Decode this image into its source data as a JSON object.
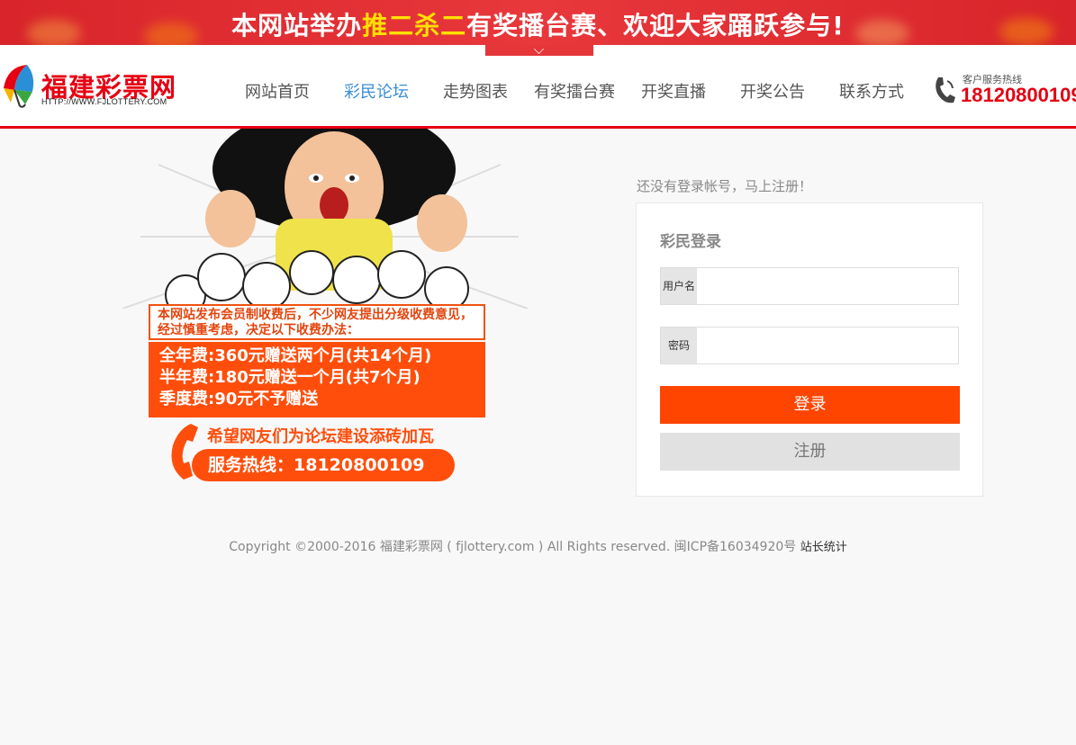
{
  "banner": {
    "text_prefix": "本网站举办",
    "text_highlight": "推二杀二",
    "text_suffix": "有奖播台赛、欢迎大家踊跃参与!"
  },
  "logo": {
    "title": "福建彩票网",
    "url": "HTTP://WWW.FJLOTTERY.COM"
  },
  "nav": {
    "items": [
      "网站首页",
      "彩民论坛",
      "走势图表",
      "有奖擂台赛",
      "开奖直播",
      "开奖公告",
      "联系方式"
    ],
    "active": "彩民论坛"
  },
  "hotline": {
    "label": "客户服务热线",
    "number": "18120800109",
    "icon": "phone-icon"
  },
  "promo": {
    "notice": "本网站发布会员制收费后，不少网友提出分级收费意见，经过慎重考虑，决定以下收费办法：",
    "prices": [
      "全年费:360元赠送两个月(共14个月)",
      "半年费:180元赠送一个月(共7个月)",
      "季度费:90元不予赠送"
    ],
    "slogan": "希望网友们为论坛建设添砖加瓦",
    "hotline": "服务热线：18120800109"
  },
  "login": {
    "signup_prompt": "还没有登录帐号，马上注册！",
    "title": "彩民登录",
    "username_label": "用户名",
    "password_label": "密码",
    "login_button": "登录",
    "register_button": "注册"
  },
  "footer": {
    "copyright": "Copyright ©2000-2016 福建彩票网 ( fjlottery.com ) All Rights reserved. 闽ICP备16034920号",
    "stats_link": "站长统计"
  },
  "colors": {
    "brand_red": "#e60012",
    "accent_orange": "#ff4500",
    "nav_active": "#3a8ed6"
  }
}
